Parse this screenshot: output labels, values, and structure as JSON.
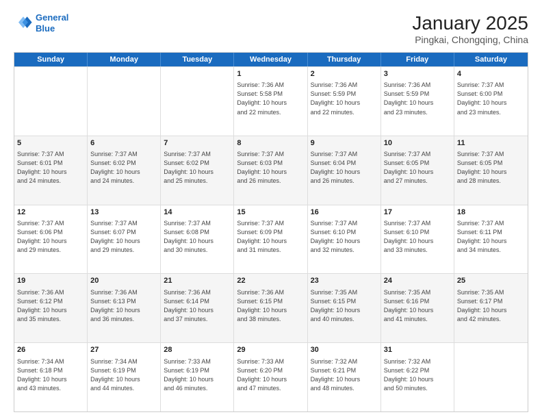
{
  "logo": {
    "line1": "General",
    "line2": "Blue"
  },
  "title": "January 2025",
  "subtitle": "Pingkai, Chongqing, China",
  "headers": [
    "Sunday",
    "Monday",
    "Tuesday",
    "Wednesday",
    "Thursday",
    "Friday",
    "Saturday"
  ],
  "rows": [
    [
      {
        "day": "",
        "info": ""
      },
      {
        "day": "",
        "info": ""
      },
      {
        "day": "",
        "info": ""
      },
      {
        "day": "1",
        "info": "Sunrise: 7:36 AM\nSunset: 5:58 PM\nDaylight: 10 hours\nand 22 minutes."
      },
      {
        "day": "2",
        "info": "Sunrise: 7:36 AM\nSunset: 5:59 PM\nDaylight: 10 hours\nand 22 minutes."
      },
      {
        "day": "3",
        "info": "Sunrise: 7:36 AM\nSunset: 5:59 PM\nDaylight: 10 hours\nand 23 minutes."
      },
      {
        "day": "4",
        "info": "Sunrise: 7:37 AM\nSunset: 6:00 PM\nDaylight: 10 hours\nand 23 minutes."
      }
    ],
    [
      {
        "day": "5",
        "info": "Sunrise: 7:37 AM\nSunset: 6:01 PM\nDaylight: 10 hours\nand 24 minutes."
      },
      {
        "day": "6",
        "info": "Sunrise: 7:37 AM\nSunset: 6:02 PM\nDaylight: 10 hours\nand 24 minutes."
      },
      {
        "day": "7",
        "info": "Sunrise: 7:37 AM\nSunset: 6:02 PM\nDaylight: 10 hours\nand 25 minutes."
      },
      {
        "day": "8",
        "info": "Sunrise: 7:37 AM\nSunset: 6:03 PM\nDaylight: 10 hours\nand 26 minutes."
      },
      {
        "day": "9",
        "info": "Sunrise: 7:37 AM\nSunset: 6:04 PM\nDaylight: 10 hours\nand 26 minutes."
      },
      {
        "day": "10",
        "info": "Sunrise: 7:37 AM\nSunset: 6:05 PM\nDaylight: 10 hours\nand 27 minutes."
      },
      {
        "day": "11",
        "info": "Sunrise: 7:37 AM\nSunset: 6:05 PM\nDaylight: 10 hours\nand 28 minutes."
      }
    ],
    [
      {
        "day": "12",
        "info": "Sunrise: 7:37 AM\nSunset: 6:06 PM\nDaylight: 10 hours\nand 29 minutes."
      },
      {
        "day": "13",
        "info": "Sunrise: 7:37 AM\nSunset: 6:07 PM\nDaylight: 10 hours\nand 29 minutes."
      },
      {
        "day": "14",
        "info": "Sunrise: 7:37 AM\nSunset: 6:08 PM\nDaylight: 10 hours\nand 30 minutes."
      },
      {
        "day": "15",
        "info": "Sunrise: 7:37 AM\nSunset: 6:09 PM\nDaylight: 10 hours\nand 31 minutes."
      },
      {
        "day": "16",
        "info": "Sunrise: 7:37 AM\nSunset: 6:10 PM\nDaylight: 10 hours\nand 32 minutes."
      },
      {
        "day": "17",
        "info": "Sunrise: 7:37 AM\nSunset: 6:10 PM\nDaylight: 10 hours\nand 33 minutes."
      },
      {
        "day": "18",
        "info": "Sunrise: 7:37 AM\nSunset: 6:11 PM\nDaylight: 10 hours\nand 34 minutes."
      }
    ],
    [
      {
        "day": "19",
        "info": "Sunrise: 7:36 AM\nSunset: 6:12 PM\nDaylight: 10 hours\nand 35 minutes."
      },
      {
        "day": "20",
        "info": "Sunrise: 7:36 AM\nSunset: 6:13 PM\nDaylight: 10 hours\nand 36 minutes."
      },
      {
        "day": "21",
        "info": "Sunrise: 7:36 AM\nSunset: 6:14 PM\nDaylight: 10 hours\nand 37 minutes."
      },
      {
        "day": "22",
        "info": "Sunrise: 7:36 AM\nSunset: 6:15 PM\nDaylight: 10 hours\nand 38 minutes."
      },
      {
        "day": "23",
        "info": "Sunrise: 7:35 AM\nSunset: 6:15 PM\nDaylight: 10 hours\nand 40 minutes."
      },
      {
        "day": "24",
        "info": "Sunrise: 7:35 AM\nSunset: 6:16 PM\nDaylight: 10 hours\nand 41 minutes."
      },
      {
        "day": "25",
        "info": "Sunrise: 7:35 AM\nSunset: 6:17 PM\nDaylight: 10 hours\nand 42 minutes."
      }
    ],
    [
      {
        "day": "26",
        "info": "Sunrise: 7:34 AM\nSunset: 6:18 PM\nDaylight: 10 hours\nand 43 minutes."
      },
      {
        "day": "27",
        "info": "Sunrise: 7:34 AM\nSunset: 6:19 PM\nDaylight: 10 hours\nand 44 minutes."
      },
      {
        "day": "28",
        "info": "Sunrise: 7:33 AM\nSunset: 6:19 PM\nDaylight: 10 hours\nand 46 minutes."
      },
      {
        "day": "29",
        "info": "Sunrise: 7:33 AM\nSunset: 6:20 PM\nDaylight: 10 hours\nand 47 minutes."
      },
      {
        "day": "30",
        "info": "Sunrise: 7:32 AM\nSunset: 6:21 PM\nDaylight: 10 hours\nand 48 minutes."
      },
      {
        "day": "31",
        "info": "Sunrise: 7:32 AM\nSunset: 6:22 PM\nDaylight: 10 hours\nand 50 minutes."
      },
      {
        "day": "",
        "info": ""
      }
    ]
  ]
}
